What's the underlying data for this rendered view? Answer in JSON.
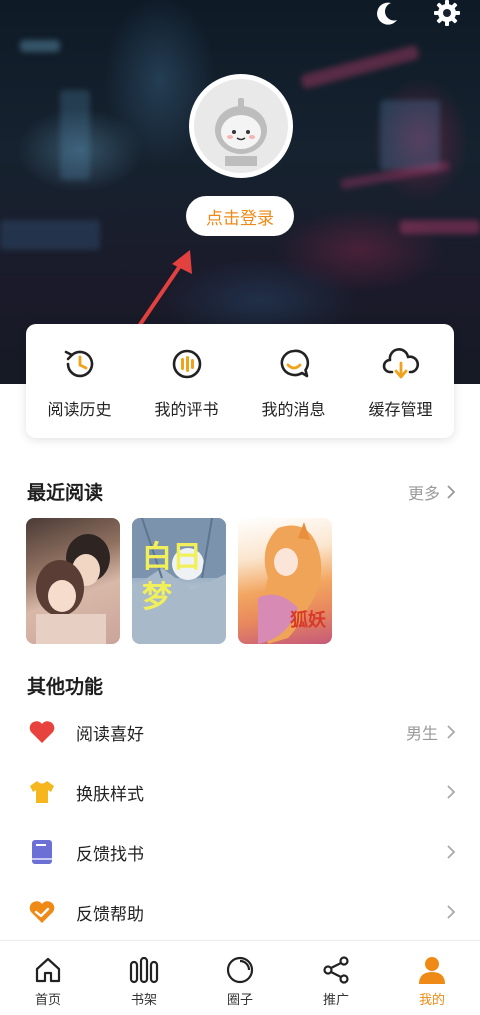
{
  "header": {
    "login_label": "点击登录"
  },
  "quick_actions": [
    {
      "label": "阅读历史",
      "icon": "history-icon"
    },
    {
      "label": "我的评书",
      "icon": "comment-book-icon"
    },
    {
      "label": "我的消息",
      "icon": "message-icon"
    },
    {
      "label": "缓存管理",
      "icon": "download-cloud-icon"
    }
  ],
  "recent": {
    "title": "最近阅读",
    "more_label": "更多",
    "covers": [
      {
        "text": ""
      },
      {
        "text": "白日梦"
      },
      {
        "text": "狐妖"
      }
    ]
  },
  "other": {
    "title": "其他功能",
    "items": [
      {
        "label": "阅读喜好",
        "value": "男生",
        "icon": "heart-icon"
      },
      {
        "label": "换肤样式",
        "value": "",
        "icon": "shirt-icon"
      },
      {
        "label": "反馈找书",
        "value": "",
        "icon": "book-icon"
      },
      {
        "label": "反馈帮助",
        "value": "",
        "icon": "help-heart-icon"
      }
    ]
  },
  "tabbar": [
    {
      "label": "首页",
      "icon": "home-icon"
    },
    {
      "label": "书架",
      "icon": "bookshelf-icon"
    },
    {
      "label": "圈子",
      "icon": "circle-icon"
    },
    {
      "label": "推广",
      "icon": "share-icon"
    },
    {
      "label": "我的",
      "icon": "user-icon",
      "active": true
    }
  ],
  "colors": {
    "accent": "#ef8a17",
    "text": "#222222",
    "muted": "#999999"
  }
}
